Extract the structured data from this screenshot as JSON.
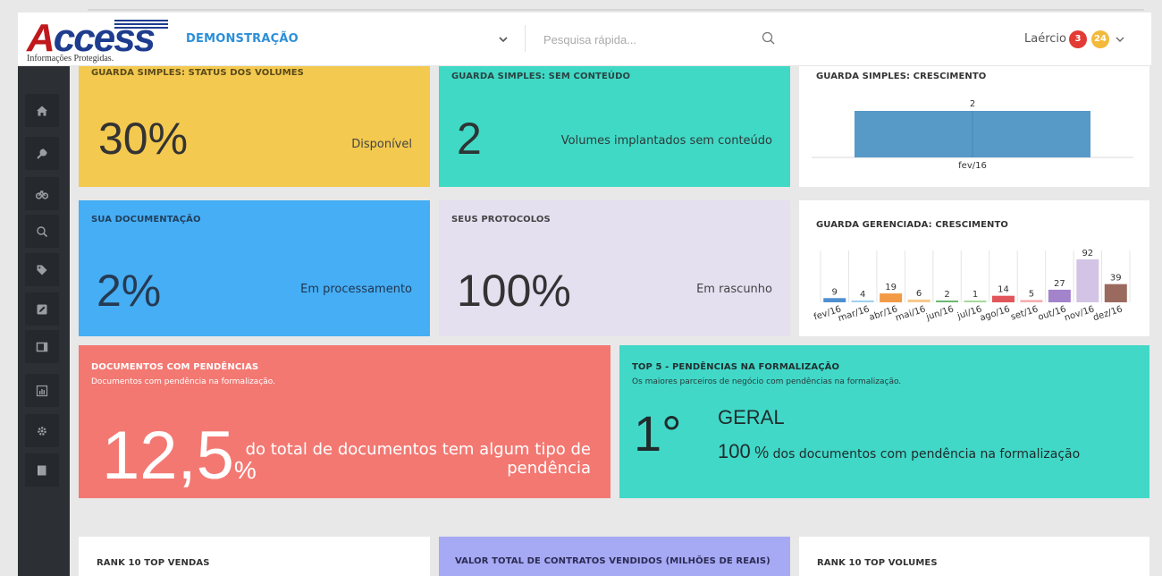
{
  "header": {
    "logo_word": "Access",
    "logo_tagline": "Informações Protegidas.",
    "brand_label": "DEMONSTRAÇÃO",
    "search_placeholder": "Pesquisa rápida...",
    "user_name": "Laércio",
    "badge_red": "3",
    "badge_yellow": "24"
  },
  "sidebar": {
    "icons": [
      "home-icon",
      "wrench-icon",
      "bicycle-icon",
      "search-icon",
      "tag-icon",
      "edit-icon",
      "window-icon",
      "chart-icon",
      "gear-icon",
      "book-icon"
    ]
  },
  "cards": {
    "status_volumes": {
      "title": "GUARDA SIMPLES: STATUS DOS VOLUMES",
      "value": "30%",
      "caption": "Disponível"
    },
    "sem_conteudo": {
      "title": "GUARDA SIMPLES: SEM CONTEÚDO",
      "value": "2",
      "caption": "Volumes implantados sem conteúdo"
    },
    "crescimento_simples": {
      "title": "GUARDA SIMPLES: CRESCIMENTO"
    },
    "documentacao": {
      "title": "SUA DOCUMENTAÇÃO",
      "value": "2%",
      "caption": "Em processamento"
    },
    "protocolos": {
      "title": "SEUS PROTOCOLOS",
      "value": "100%",
      "caption": "Em rascunho"
    },
    "crescimento_gerenciada": {
      "title": "GUARDA GERENCIADA: CRESCIMENTO"
    },
    "pendencias": {
      "title": "DOCUMENTOS COM PENDÊNCIAS",
      "subtitle": "Documentos com pendência na formalização.",
      "value": "12,5",
      "unit": "%",
      "caption_line1": "do total de documentos tem algum tipo de",
      "caption_line2": "pendência"
    },
    "top5": {
      "title": "TOP 5 - PENDÊNCIAS NA FORMALIZAÇÃO",
      "subtitle": "Os maiores parceiros de negócio com pendências na formalização.",
      "rank": "1°",
      "partner": "GERAL",
      "percent": "100",
      "percent_sign": "%",
      "caption": "dos documentos com pendência na formalização"
    },
    "rank_vendas": {
      "title": "RANK 10 TOP VENDAS"
    },
    "valor_contratos": {
      "title": "VALOR TOTAL DE CONTRATOS VENDIDOS (MILHÕES DE REAIS)"
    },
    "rank_volumes": {
      "title": "RANK 10 TOP VOLUMES"
    }
  },
  "chart_data": [
    {
      "type": "bar",
      "title": "GUARDA SIMPLES: CRESCIMENTO",
      "categories": [
        "fev/16"
      ],
      "values": [
        2
      ],
      "colors": [
        "#5799c7"
      ]
    },
    {
      "type": "bar",
      "title": "GUARDA GERENCIADA: CRESCIMENTO",
      "categories": [
        "fev/16",
        "mar/16",
        "abr/16",
        "mai/16",
        "jun/16",
        "jul/16",
        "ago/16",
        "set/16",
        "out/16",
        "nov/16",
        "dez/16"
      ],
      "values": [
        9,
        4,
        19,
        6,
        2,
        1,
        14,
        5,
        27,
        92,
        39
      ],
      "colors": [
        "#4e8fd0",
        "#9fd0f2",
        "#f29a45",
        "#f5c98d",
        "#6bb870",
        "#a7d898",
        "#e2555a",
        "#f4aeb0",
        "#a383cb",
        "#d3c4e6",
        "#9b6a5f"
      ]
    }
  ]
}
